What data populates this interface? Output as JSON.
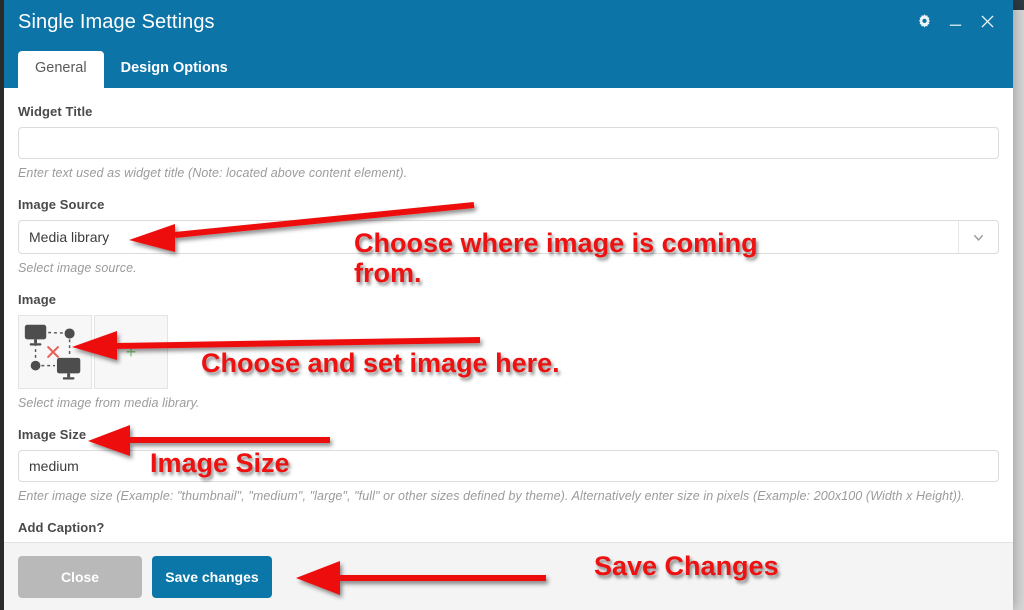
{
  "window": {
    "title": "Single Image Settings",
    "controls": [
      {
        "name": "gear-icon",
        "label": "Settings"
      },
      {
        "name": "minimize-icon",
        "label": "Minimize"
      },
      {
        "name": "close-icon",
        "label": "Close"
      }
    ],
    "header_color": "#0d74a8"
  },
  "tabs": [
    {
      "label": "General",
      "active": true
    },
    {
      "label": "Design Options",
      "active": false
    }
  ],
  "form": {
    "widget_title": {
      "label": "Widget Title",
      "value": "",
      "placeholder": "",
      "help": "Enter text used as widget title (Note: located above content element)."
    },
    "image_source": {
      "label": "Image Source",
      "value": "Media library",
      "help": "Select image source.",
      "options": [
        "Media library"
      ]
    },
    "image": {
      "label": "Image",
      "help": "Select image from media library.",
      "thumb_alt": "network-diagram-thumbnail",
      "add_label": "+"
    },
    "image_size": {
      "label": "Image Size",
      "value": "medium",
      "placeholder": "",
      "help": "Enter image size (Example: \"thumbnail\", \"medium\", \"large\", \"full\" or other sizes defined by theme). Alternatively enter size in pixels (Example: 200x100 (Width x Height))."
    },
    "add_caption": {
      "label": "Add Caption?"
    }
  },
  "footer": {
    "close_label": "Close",
    "save_label": "Save changes",
    "save_color": "#0b76a8",
    "close_color": "#b9b9b9"
  },
  "annotations": {
    "color": "#ee1111",
    "items": [
      {
        "name": "annotation-image-source",
        "text": "Choose where image is coming\nfrom.",
        "font_size": "27px"
      },
      {
        "name": "annotation-image-picker",
        "text": "Choose and set image here.",
        "font_size": "27px"
      },
      {
        "name": "annotation-image-size",
        "text": "Image Size",
        "font_size": "27px"
      },
      {
        "name": "annotation-save-changes",
        "text": "Save Changes",
        "font_size": "27px"
      }
    ]
  }
}
